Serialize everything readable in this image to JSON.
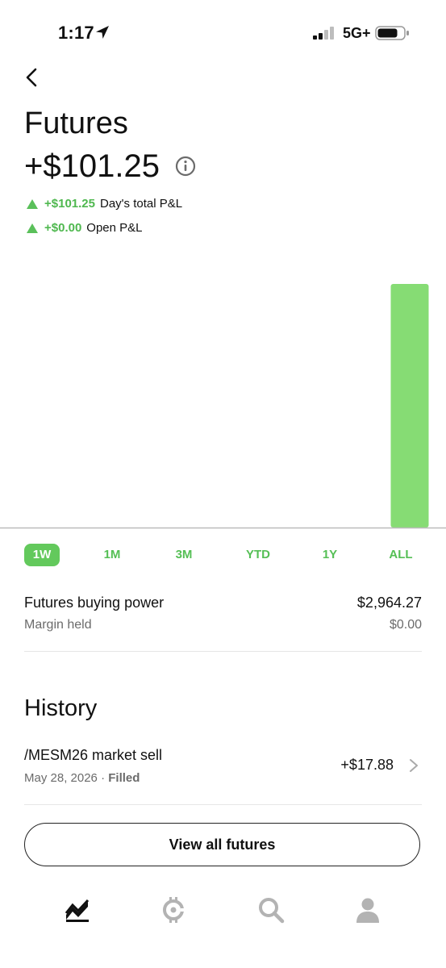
{
  "status_bar": {
    "time": "1:17",
    "network": "5G+"
  },
  "header": {
    "title": "Futures",
    "amount": "+$101.25",
    "day_pl": {
      "value": "+$101.25",
      "label": "Day's total P&L"
    },
    "open_pl": {
      "value": "+$0.00",
      "label": "Open P&L"
    }
  },
  "chart_data": {
    "type": "bar",
    "categories": [
      "",
      "",
      "",
      "",
      "",
      "",
      "",
      "",
      "",
      ""
    ],
    "values": [
      0,
      0,
      0,
      0,
      0,
      0,
      0,
      0,
      0,
      101.25
    ],
    "title": "",
    "xlabel": "",
    "ylabel": "",
    "ylim": [
      0,
      101.25
    ],
    "grid": false,
    "colors": {
      "bar": "#86dc74",
      "baseline": "#bbbbbb"
    }
  },
  "range_tabs": [
    {
      "label": "1W",
      "active": true
    },
    {
      "label": "1M",
      "active": false
    },
    {
      "label": "3M",
      "active": false
    },
    {
      "label": "YTD",
      "active": false
    },
    {
      "label": "1Y",
      "active": false
    },
    {
      "label": "ALL",
      "active": false
    }
  ],
  "buying_power": {
    "label": "Futures buying power",
    "value": "$2,964.27",
    "margin_label": "Margin held",
    "margin_value": "$0.00"
  },
  "history": {
    "title": "History",
    "items": [
      {
        "title": "/MESM26 market sell",
        "date": "May 28, 2026",
        "status": "Filled",
        "amount": "+$17.88"
      }
    ]
  },
  "view_all_button": "View all futures",
  "nav": [
    {
      "icon": "investing-chart-icon",
      "active": true
    },
    {
      "icon": "crypto-icon",
      "active": false
    },
    {
      "icon": "search-icon",
      "active": false
    },
    {
      "icon": "account-icon",
      "active": false
    }
  ],
  "colors": {
    "accent": "#63c95c",
    "positive": "#4fb84f"
  }
}
